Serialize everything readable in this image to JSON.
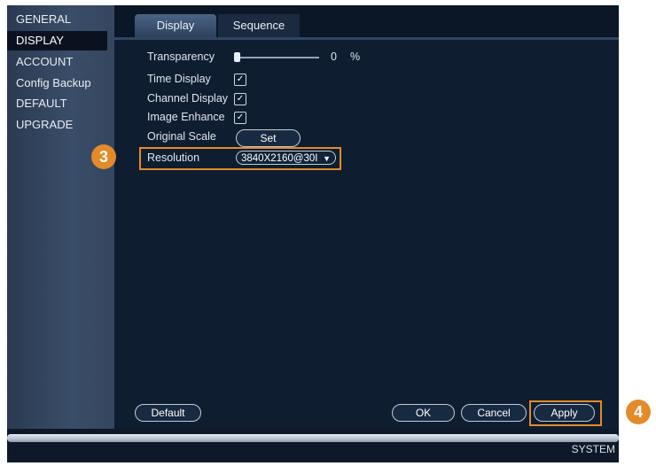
{
  "sidebar": {
    "items": [
      {
        "label": "GENERAL",
        "active": false
      },
      {
        "label": "DISPLAY",
        "active": true
      },
      {
        "label": "ACCOUNT",
        "active": false
      },
      {
        "label": "Config Backup",
        "active": false
      },
      {
        "label": "DEFAULT",
        "active": false
      },
      {
        "label": "UPGRADE",
        "active": false
      }
    ]
  },
  "tabs": [
    {
      "label": "Display",
      "active": true
    },
    {
      "label": "Sequence",
      "active": false
    }
  ],
  "settings": {
    "transparency": {
      "label": "Transparency",
      "value": "0",
      "unit": "%",
      "level": 0
    },
    "time_display": {
      "label": "Time Display",
      "checked": true
    },
    "channel_display": {
      "label": "Channel Display",
      "checked": true
    },
    "image_enhance": {
      "label": "Image Enhance",
      "checked": true
    },
    "original_scale": {
      "label": "Original Scale",
      "button": "Set"
    },
    "resolution": {
      "label": "Resolution",
      "value": "3840X2160@30I"
    }
  },
  "callouts": {
    "resolution": "3",
    "apply": "4"
  },
  "buttons": {
    "default": "Default",
    "ok": "OK",
    "cancel": "Cancel",
    "apply": "Apply"
  },
  "footer": {
    "label": "SYSTEM"
  },
  "colors": {
    "accent": "#e38b29",
    "panel": "#0f1d30",
    "sidebar": "#3a4d68"
  }
}
